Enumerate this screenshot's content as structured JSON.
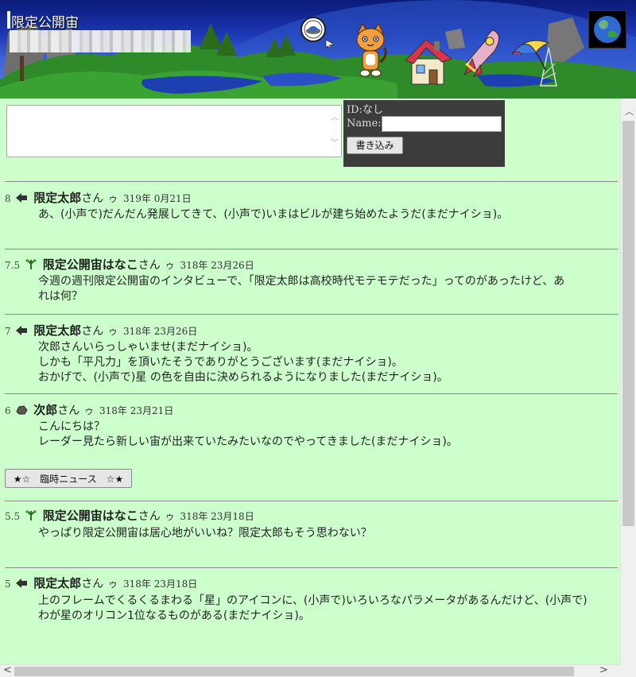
{
  "header": {
    "title": "限定公開宙"
  },
  "form": {
    "id_label": "ID:なし",
    "name_label": "Name:",
    "name_value": "",
    "message_value": "",
    "submit_label": "書き込み"
  },
  "news_button_label": "★☆　臨時ニュース　☆★",
  "posts": [
    {
      "number": "8",
      "icon": "arrow-icon",
      "author": "限定太郎",
      "san": "さん",
      "u": "ゥ",
      "date": "319年 0月21日",
      "lines": [
        "あ、(小声で)だんだん発展してきて、(小声で)いまはビルが建ち始めたようだ(まだナイショ)。"
      ]
    },
    {
      "number": "7.5",
      "icon": "flower-icon",
      "author": "限定公開宙はなこ",
      "san": "さん",
      "u": "ゥ",
      "date": "318年 23月26日",
      "lines": [
        "今週の週刊限定公開宙のインタビューで、「限定太郎は高校時代モテモテだった」ってのがあったけど、あ",
        "れは何？"
      ]
    },
    {
      "number": "7",
      "icon": "arrow-icon",
      "author": "限定太郎",
      "san": "さん",
      "u": "ゥ",
      "date": "318年 23月26日",
      "lines": [
        "次郎さんいらっしゃいませ(まだナイショ)。",
        "しかも「平凡力」を頂いたそうでありがとうございます(まだナイショ)。",
        "おかげで、(小声で)星 の色を自由に決められるようになりました(まだナイショ)。"
      ]
    },
    {
      "number": "6",
      "icon": "rock-icon",
      "author": "次郎",
      "san": "さん",
      "u": "ゥ",
      "date": "318年 23月21日",
      "lines": [
        "こんにちは？",
        "レーダー見たら新しい宙が出来ていたみたいなのでやってきました(まだナイショ)。"
      ]
    },
    {
      "number": "5.5",
      "icon": "flower-icon",
      "author": "限定公開宙はなこ",
      "san": "さん",
      "u": "ゥ",
      "date": "318年 23月18日",
      "lines": [
        "やっぱり限定公開宙は居心地がいいね？限定太郎もそう思わない？"
      ]
    },
    {
      "number": "5",
      "icon": "arrow-icon",
      "author": "限定太郎",
      "san": "さん",
      "u": "ゥ",
      "date": "318年 23月18日",
      "lines": [
        "上のフレームでくるくるまわる「星」のアイコンに、(小声で)いろいろなパラメータがあるんだけど、(小声で)",
        "わが星のオリコン1位なるものがある(まだナイショ)。"
      ]
    }
  ]
}
